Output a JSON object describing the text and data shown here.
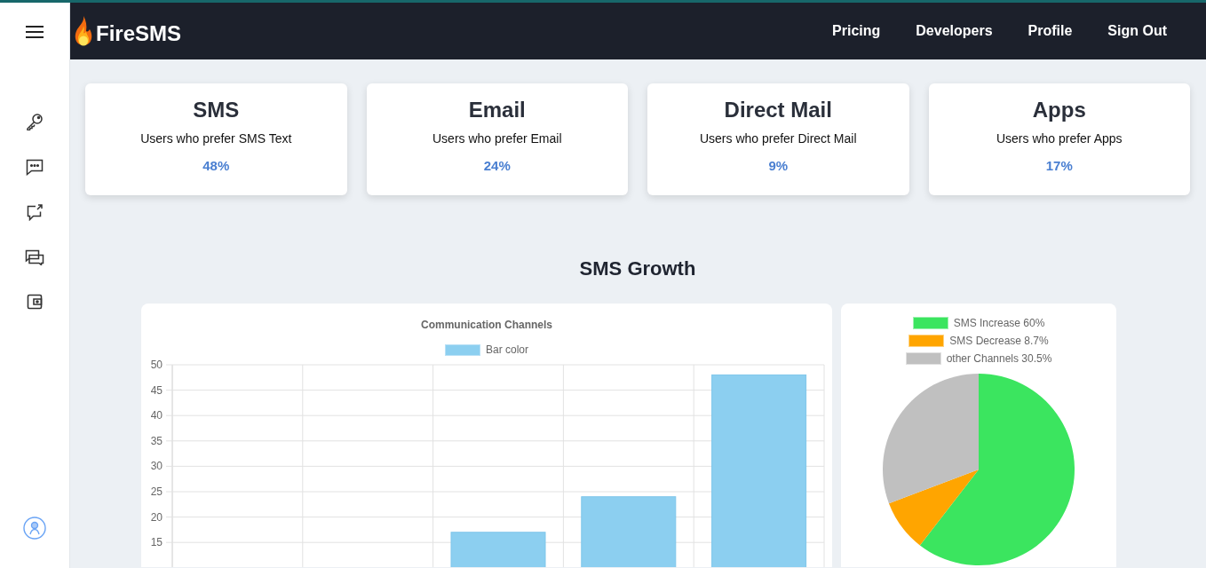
{
  "header": {
    "logo": "FireSMS",
    "nav": [
      {
        "label": "Pricing"
      },
      {
        "label": "Developers"
      },
      {
        "label": "Profile"
      },
      {
        "label": "Sign Out"
      }
    ]
  },
  "stats": [
    {
      "title": "SMS",
      "subtitle": "Users who prefer SMS Text",
      "value": "48%"
    },
    {
      "title": "Email",
      "subtitle": "Users who prefer Email",
      "value": "24%"
    },
    {
      "title": "Direct Mail",
      "subtitle": "Users who prefer Direct Mail",
      "value": "9%"
    },
    {
      "title": "Apps",
      "subtitle": "Users who prefer Apps",
      "value": "17%"
    }
  ],
  "section_title": "SMS Growth",
  "bar_chart": {
    "chart_data": {
      "type": "bar",
      "title": "Communication Channels",
      "series": [
        {
          "name": "Bar color",
          "color": "#8ccff0",
          "values": [
            null,
            null,
            17,
            24,
            48
          ]
        }
      ],
      "ylim": [
        0,
        50
      ],
      "yticks": [
        15,
        20,
        25,
        30,
        35,
        40,
        45,
        50
      ],
      "grid": true
    }
  },
  "pie_chart": {
    "chart_data": {
      "type": "pie",
      "categories": [
        "SMS Increase 60%",
        "SMS Decrease 8.7%",
        "other Channels 30.5%"
      ],
      "values": [
        60,
        8.7,
        30.5
      ],
      "colors": [
        "#3be55f",
        "#ffa500",
        "#c0c0c0"
      ]
    }
  }
}
